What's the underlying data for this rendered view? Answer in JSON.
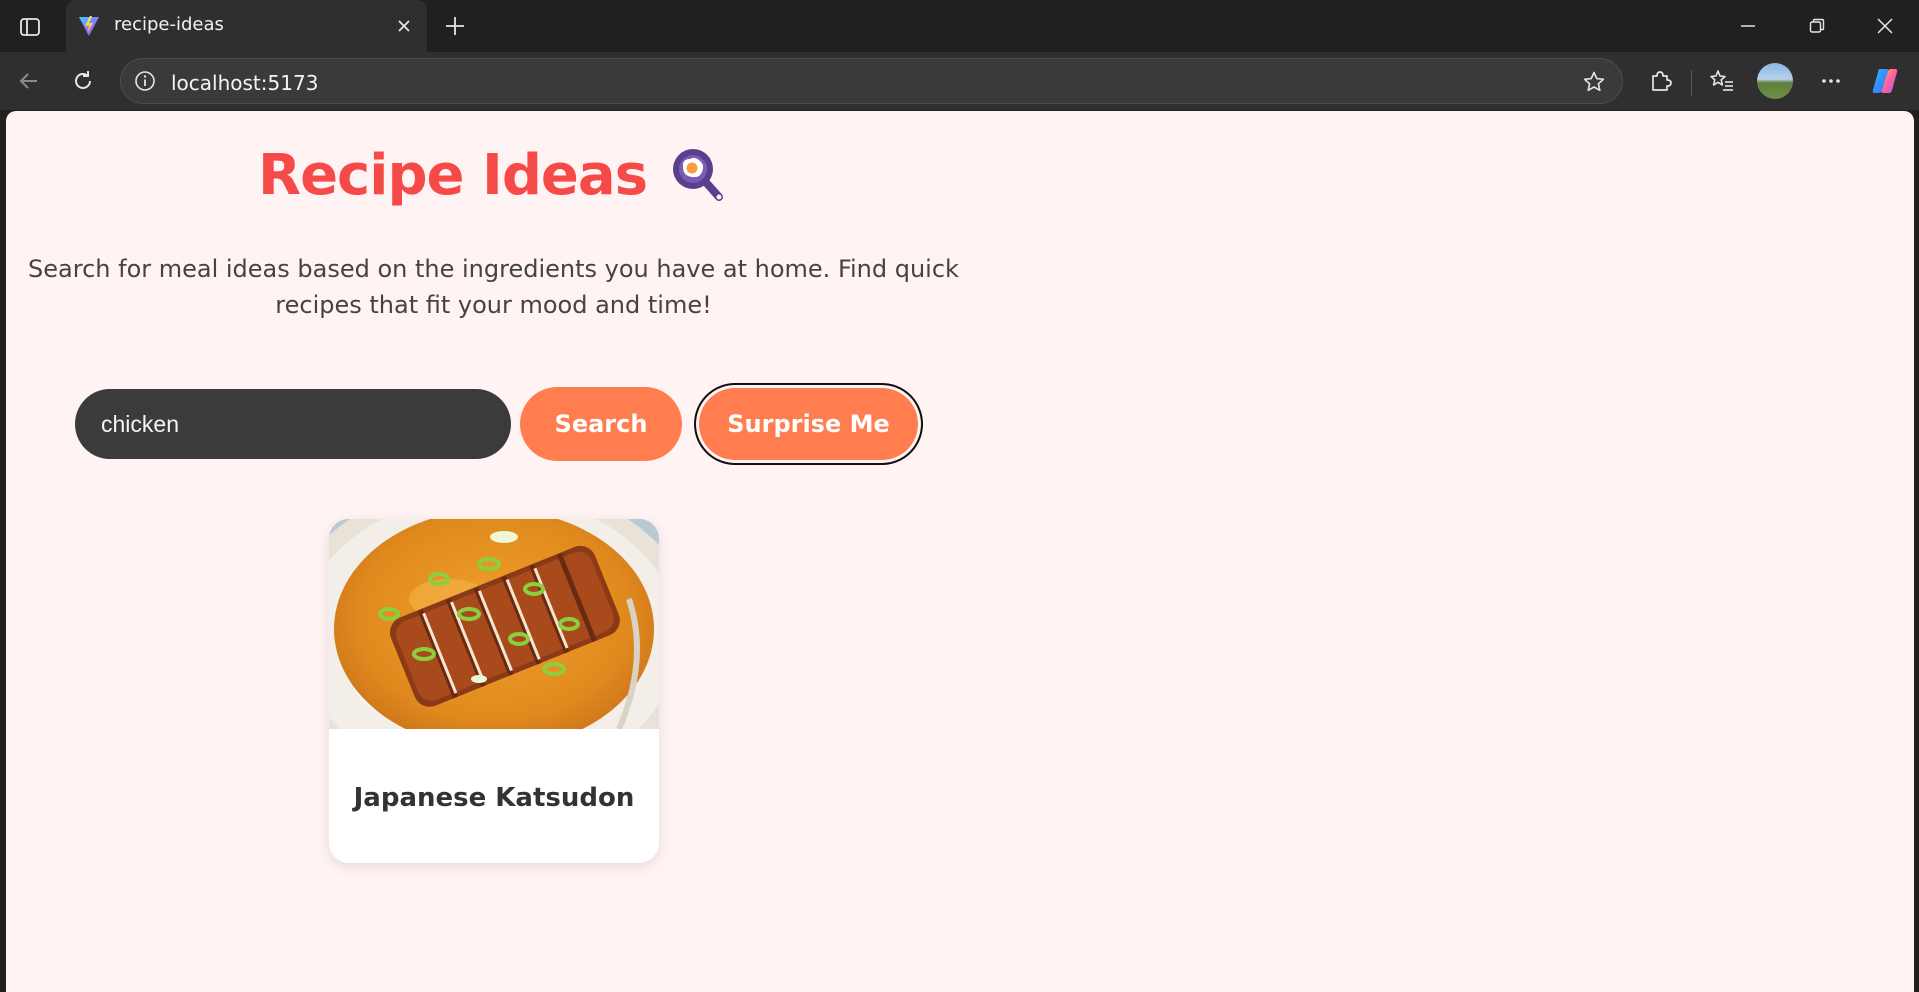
{
  "browser": {
    "tab": {
      "title": "recipe-ideas"
    },
    "address_bar": {
      "url": "localhost:5173"
    }
  },
  "page": {
    "title": "Recipe Ideas",
    "subtitle": "Search for meal ideas based on the ingredients you have at home. Find quick recipes that fit your mood and time!",
    "search": {
      "value": "chicken"
    },
    "search_button_label": "Search",
    "surprise_button_label": "Surprise Me",
    "results": [
      {
        "name": "Japanese Katsudon"
      }
    ]
  },
  "colors": {
    "title": "#f54a48",
    "accent": "#ff7d4f",
    "page_bg": "#fff3f3",
    "input_bg": "#3b3b3b"
  }
}
